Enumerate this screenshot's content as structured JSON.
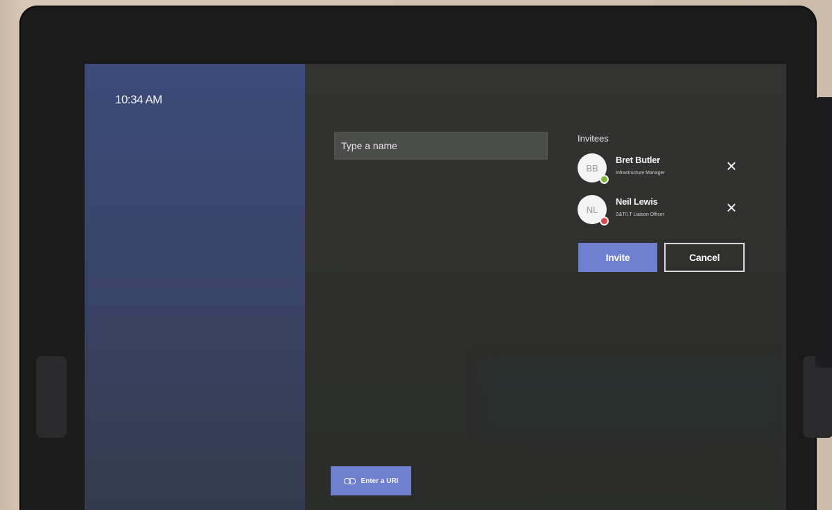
{
  "time": "10:34 AM",
  "search": {
    "placeholder": "Type a name"
  },
  "invitees": {
    "heading": "Invitees",
    "people": [
      {
        "initials": "BB",
        "name": "Bret Butler",
        "title": "Infrastructure Manager",
        "presence_color": "#7fbc41"
      },
      {
        "initials": "NL",
        "name": "Neil Lewis",
        "title": "S&T/I.T Liaison Officer",
        "presence_color": "#d94c4c"
      }
    ]
  },
  "actions": {
    "invite_label": "Invite",
    "cancel_label": "Cancel"
  },
  "url_button": {
    "label": "Enter a URI"
  },
  "colors": {
    "accent": "#6e7fd1"
  },
  "icons": {
    "remove": "close-icon",
    "url": "link-icon"
  }
}
